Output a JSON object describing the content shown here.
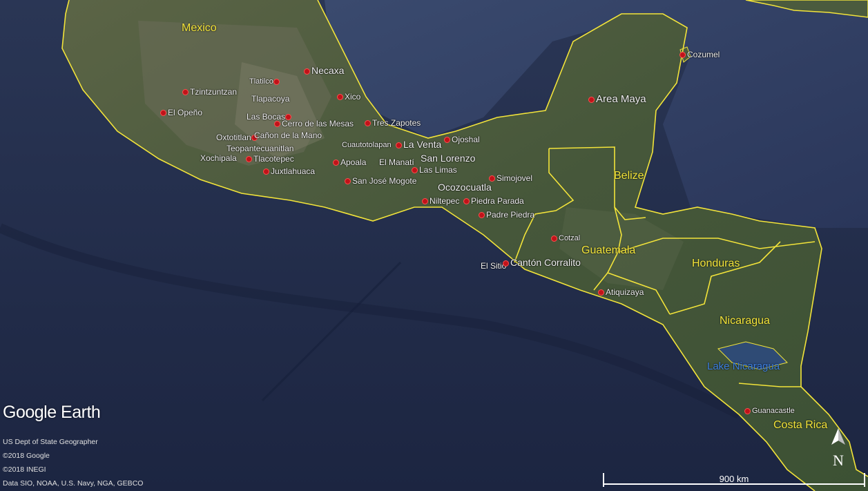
{
  "logo": "Google Earth",
  "credits": [
    "US Dept of State Geographer",
    "©2018 Google",
    "©2018 INEGI",
    "Data SIO, NOAA, U.S. Navy, NGA, GEBCO"
  ],
  "scale_label": "900 km",
  "compass_label": "N",
  "countries": {
    "mexico": "Mexico",
    "belize": "Belize",
    "guatemala": "Guatemala",
    "honduras": "Honduras",
    "nicaragua": "Nicaragua",
    "costa_rica": "Costa Rica"
  },
  "lake": "Lake Nicaragua",
  "sites": {
    "necaxa": "Necaxa",
    "tlatilco": "Tlatilco",
    "tzintzuntzan": "Tzintzuntzan",
    "tlapacoya": "Tlapacoya",
    "xico": "Xico",
    "el_openo": "El Opeño",
    "las_bocas": "Las Bocas",
    "cerro_de_las_mesas": "Cerro de las Mesas",
    "tres_zapotes": "Tres Zapotes",
    "oxtotitlan": "Oxtotitlan",
    "canon_de_la_mano": "Cañon de la Mano",
    "teopantecuanitlan": "Teopantecuanitlan",
    "cuautotolapan": "Cuautotolapan",
    "la_venta": "La Venta",
    "ojoshal": "Ojoshal",
    "xochipala": "Xochipala",
    "tlacotepec": "Tlacotepec",
    "apoala": "Apoala",
    "el_manati": "El Manatí",
    "san_lorenzo": "San Lorenzo",
    "las_limas": "Las Limas",
    "juxtlahuaca": "Juxtlahuaca",
    "simojovel": "Simojovel",
    "san_jose_mogote": "San José Mogote",
    "ocozocuatla": "Ocozocuatla",
    "niltepec": "Niltepec",
    "piedra_parada": "Piedra Parada",
    "padre_piedra": "Padre Piedra",
    "cotzal": "Cotzal",
    "el_sitio": "El Sitio",
    "canton_corralito": "Cantón Corralito",
    "atiquizaya": "Atiquizaya",
    "area_maya": "Area Maya",
    "cozumel": "Cozumel",
    "guanacastle": "Guanacastle"
  },
  "colors": {
    "ocean": "#1f2a45",
    "land": "#4a5a3a",
    "border": "#f3e43a",
    "site_marker": "#c0131a",
    "lake_label": "#3d7fe0"
  }
}
